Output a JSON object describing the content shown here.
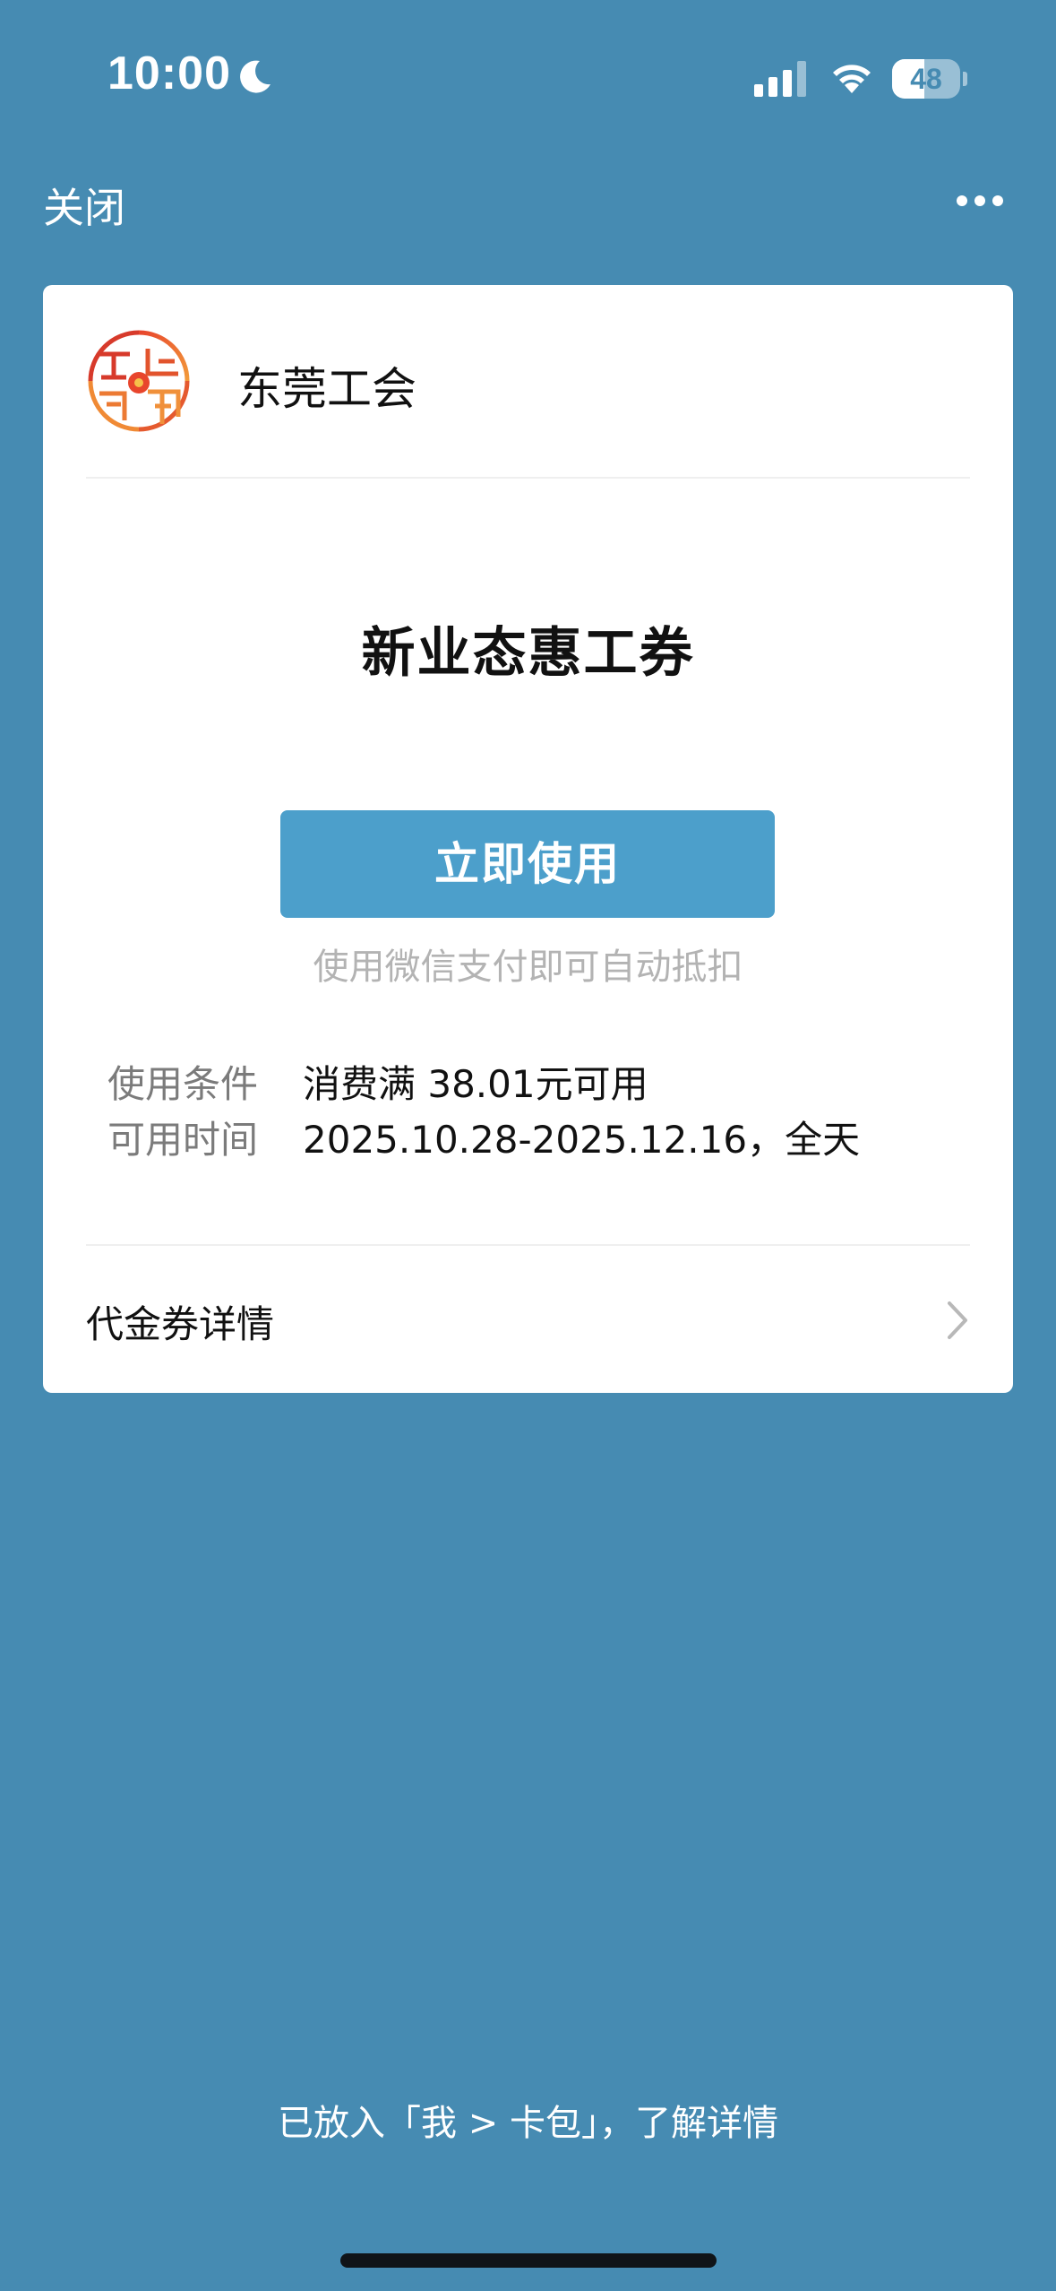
{
  "status_bar": {
    "time": "10:00",
    "battery_level": "48",
    "battery_fraction": 0.48,
    "icons": [
      "moon-icon",
      "signal-icon",
      "wifi-icon",
      "battery-icon"
    ]
  },
  "nav": {
    "close_label": "关闭",
    "more_icon": "more-dots-icon"
  },
  "merchant": {
    "name": "东莞工会",
    "logo_icon": "union-logo-icon"
  },
  "coupon": {
    "title": "新业态惠工券",
    "use_button_label": "立即使用",
    "pay_hint": "使用微信支付即可自动抵扣",
    "conditions": [
      {
        "label": "使用条件",
        "value": "消费满 38.01元可用"
      },
      {
        "label": "可用时间",
        "value": "2025.10.28-2025.12.16，全天"
      }
    ],
    "details_label": "代金券详情"
  },
  "footer": {
    "text": "已放入「我 > 卡包」，了解详情"
  },
  "colors": {
    "background": "#468bb2",
    "card": "#ffffff",
    "button": "#4c9fcb",
    "hint": "#b3b3b3",
    "label": "#7b7b7b"
  }
}
